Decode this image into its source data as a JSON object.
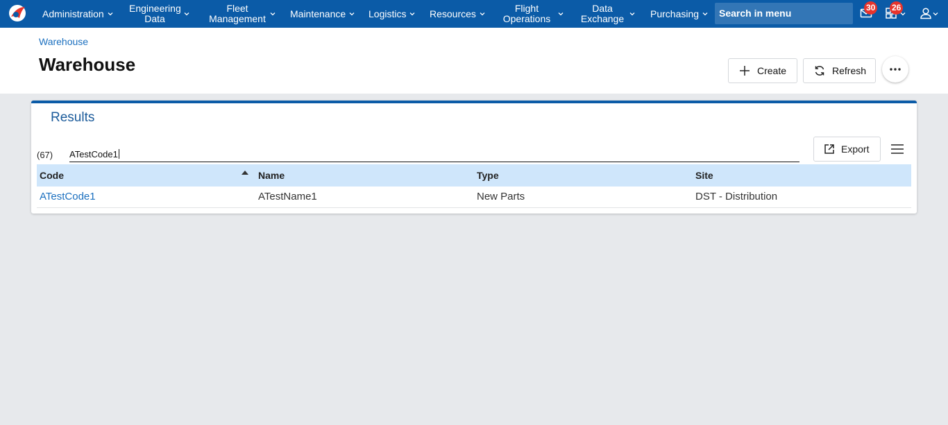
{
  "nav": {
    "items": [
      {
        "label": "Administration"
      },
      {
        "label": "Engineering Data"
      },
      {
        "label": "Fleet Management"
      },
      {
        "label": "Maintenance"
      },
      {
        "label": "Logistics"
      },
      {
        "label": "Resources"
      },
      {
        "label": "Flight Operations"
      },
      {
        "label": "Data Exchange"
      },
      {
        "label": "Purchasing"
      }
    ],
    "search_label": "Search in menu",
    "mail_badge": "30",
    "tasks_badge": "26",
    "accent_color": "#0b5ba7",
    "badge_color": "#e8342c"
  },
  "header": {
    "breadcrumb": "Warehouse",
    "title": "Warehouse",
    "create_label": "Create",
    "refresh_label": "Refresh"
  },
  "results": {
    "title": "Results",
    "count": "(67)",
    "filter_value": "ATestCode1",
    "export_label": "Export",
    "columns": [
      "Code",
      "Name",
      "Type",
      "Site"
    ],
    "sorted_column": "Code",
    "rows": [
      {
        "code": "ATestCode1",
        "name": "ATestName1",
        "type": "New Parts",
        "site": "DST - Distribution"
      }
    ]
  }
}
